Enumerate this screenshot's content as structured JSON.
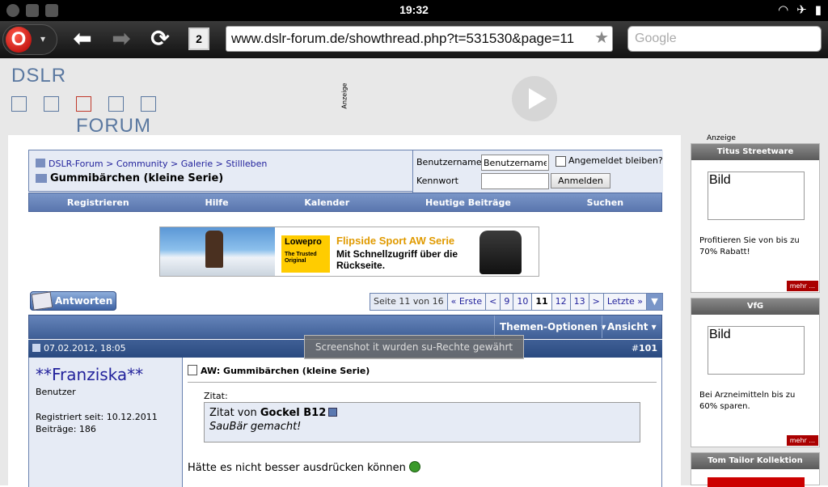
{
  "status": {
    "time": "19:32"
  },
  "browser": {
    "tab_count": "2",
    "url": "www.dslr-forum.de/showthread.php?t=531530&page=11",
    "search_placeholder": "Google"
  },
  "site": {
    "logo_top": "DSLR",
    "logo_bottom": "FORUM",
    "ad_label": "Anzeige"
  },
  "breadcrumb": {
    "items": [
      "DSLR-Forum",
      "Community",
      "Galerie",
      "Stillleben"
    ],
    "separator": ">",
    "thread_title": "Gummibärchen (kleine Serie)"
  },
  "login": {
    "username_label": "Benutzername",
    "username_value": "Benutzername",
    "password_label": "Kennwort",
    "remember_label": "Angemeldet bleiben?",
    "login_button": "Anmelden"
  },
  "menu": {
    "items": [
      "Registrieren",
      "Hilfe",
      "Kalender",
      "Heutige Beiträge",
      "Suchen"
    ]
  },
  "banner": {
    "brand": "Lowepro",
    "brand_tagline": "The Trusted Original",
    "headline": "Flipside Sport AW Serie",
    "subline": "Mit Schnellzugriff über die Rückseite."
  },
  "reply_button": "Antworten",
  "pagination": {
    "label": "Seite 11 von 16",
    "first": "« Erste",
    "prev": "<",
    "pages": [
      "9",
      "10",
      "11",
      "12",
      "13"
    ],
    "current": "11",
    "next": ">",
    "last": "Letzte »",
    "dropdown": "▼"
  },
  "thread_tools": {
    "options": "Themen-Optionen",
    "view": "Ansicht"
  },
  "post": {
    "date": "07.02.2012, 18:05",
    "number_prefix": "#",
    "number": "101",
    "username": "**Franziska**",
    "user_title": "Benutzer",
    "registered": "Registriert seit: 10.12.2011",
    "posts": "Beiträge: 186",
    "title": "AW: Gummibärchen (kleine Serie)",
    "quote_label": "Zitat:",
    "quote_from": "Zitat von",
    "quote_author": "Gockel B12",
    "quote_text": "SauBär gemacht!",
    "body": "Hätte es nicht besser ausdrücken können"
  },
  "toast": "Screenshot it wurden su-Rechte gewährt",
  "sidebar": {
    "ad_label": "Anzeige",
    "boxes": [
      {
        "title": "Titus Streetware",
        "image": "Bild",
        "text": "Profitieren Sie von bis zu 70% Rabatt!",
        "more": "mehr ..."
      },
      {
        "title": "VfG",
        "image": "Bild",
        "text": "Bei Arzneimitteln bis zu 60% sparen.",
        "more": "mehr ..."
      },
      {
        "title": "Tom Tailor Kollektion"
      }
    ]
  }
}
